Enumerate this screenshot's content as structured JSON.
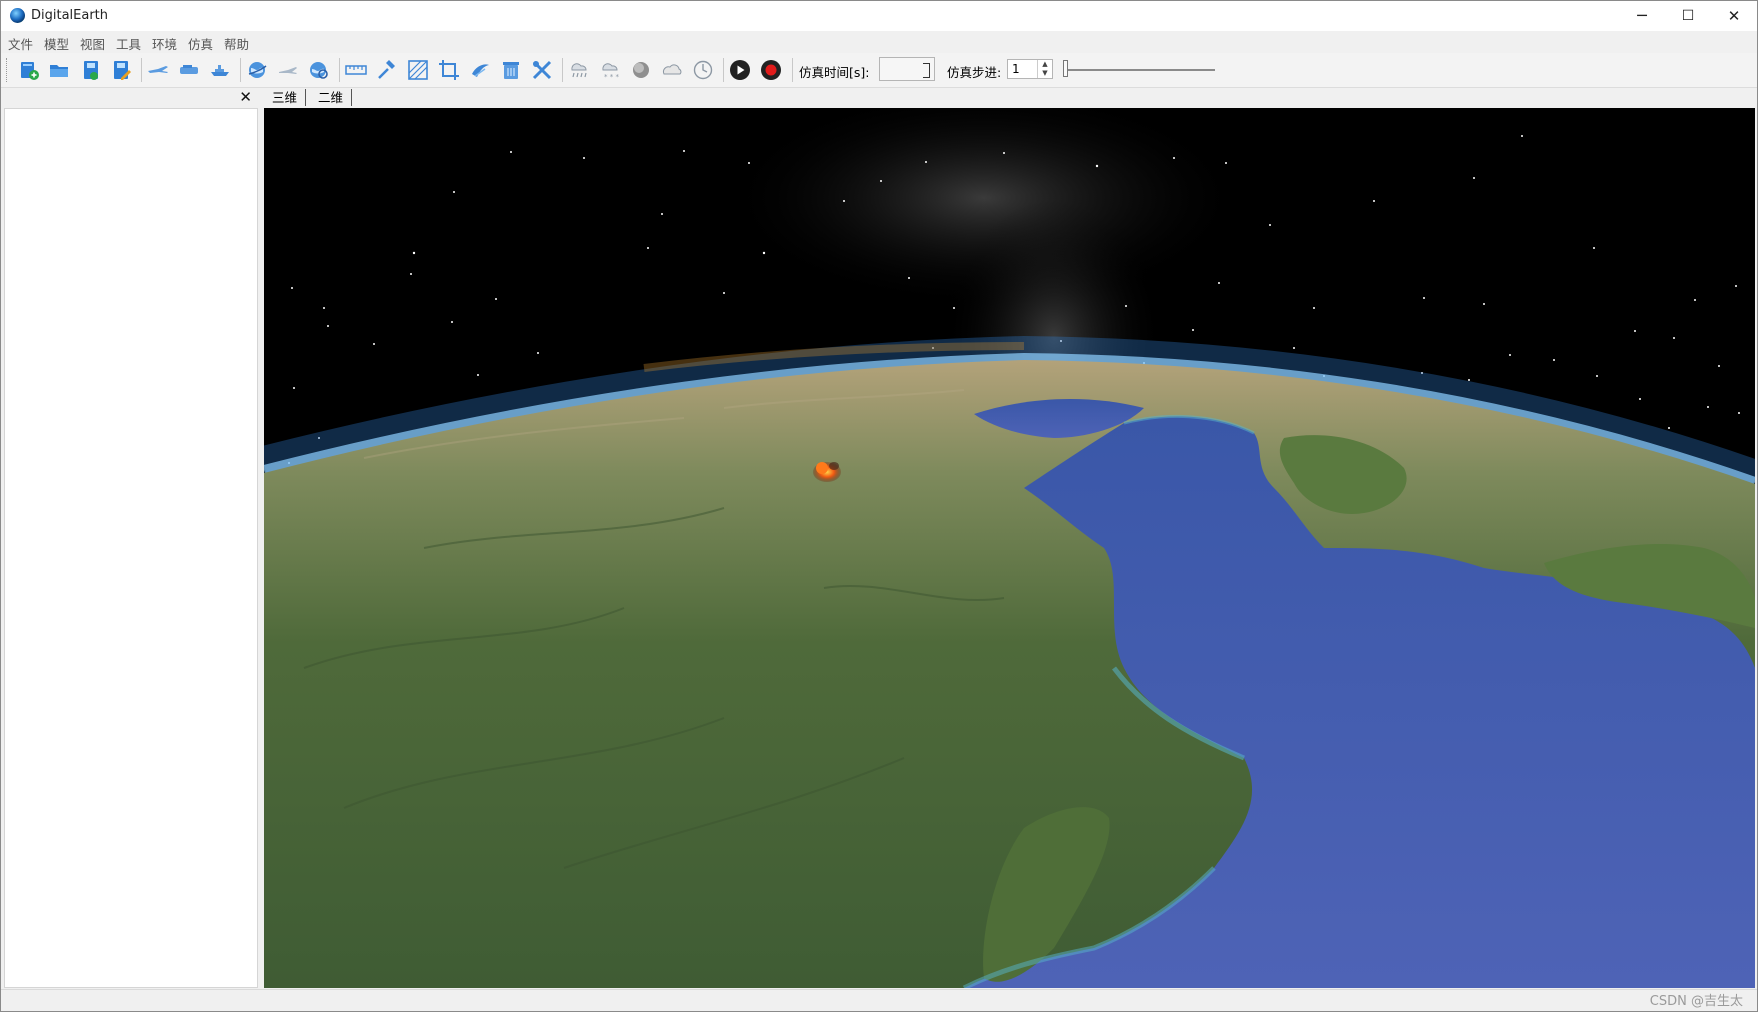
{
  "window": {
    "title": "DigitalEarth",
    "controls": {
      "minimize": "─",
      "maximize": "☐",
      "close": "✕"
    }
  },
  "menu": [
    "文件",
    "模型",
    "视图",
    "工具",
    "环境",
    "仿真",
    "帮助"
  ],
  "toolbar": {
    "sim_time_label": "仿真时间[s]:",
    "sim_time_value": "",
    "sim_step_label": "仿真步进:",
    "sim_step_value": "1",
    "step_slider_level": 0.0
  },
  "left_panel": {
    "close_glyph": "✕"
  },
  "tabs": [
    "三维",
    "二维"
  ],
  "watermark": "CSDN @吉生太",
  "colors": {
    "accent_blue": "#2f7fd6",
    "ocean": "#4a5fb0",
    "land": "#4f6a3a",
    "space": "#000000"
  }
}
